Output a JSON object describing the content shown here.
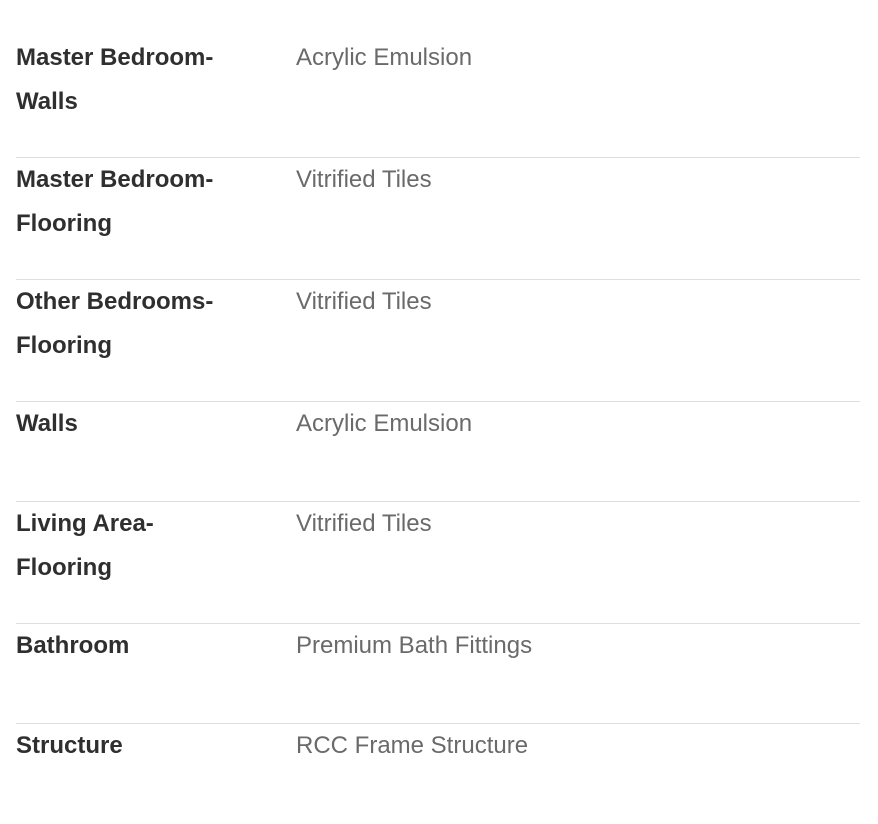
{
  "specifications": [
    {
      "label": "Master Bedroom-\nWalls",
      "value": "Acrylic Emulsion"
    },
    {
      "label": "Master Bedroom-\nFlooring",
      "value": "Vitrified Tiles"
    },
    {
      "label": "Other Bedrooms-\nFlooring",
      "value": "Vitrified Tiles"
    },
    {
      "label": "Walls",
      "value": "Acrylic Emulsion"
    },
    {
      "label": "Living Area-\nFlooring",
      "value": "Vitrified Tiles"
    },
    {
      "label": "Bathroom",
      "value": "Premium Bath Fittings"
    },
    {
      "label": "Structure",
      "value": "RCC Frame Structure"
    }
  ]
}
